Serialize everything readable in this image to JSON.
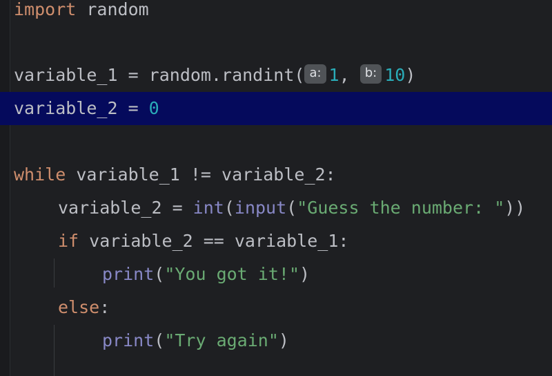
{
  "editor": {
    "colors": {
      "background": "#1e1f22",
      "current_line": "#050a5c",
      "keyword": "#cf8e6d",
      "builtin": "#8888c6",
      "string": "#6aab73",
      "number": "#2aacb8",
      "text": "#bcbec4",
      "inlay_hint_bg": "#505357"
    },
    "lines": [
      {
        "kw": "import",
        "rest": " random"
      },
      {},
      {
        "lhs": "variable_1 = random.randint(",
        "hint_a": "a:",
        "arg_a": "1",
        "sep": ", ",
        "hint_b": "b:",
        "arg_b": "10",
        "close": ")"
      },
      {
        "lhs": "variable_2 = ",
        "value": "0"
      },
      {},
      {
        "kw": "while",
        "rest": " variable_1 != variable_2:"
      },
      {
        "lhs": "variable_2 = ",
        "fn1": "int",
        "p1": "(",
        "fn2": "input",
        "p2": "(",
        "str": "\"Guess the number: \"",
        "close": "))"
      },
      {
        "kw": "if",
        "rest": " variable_2 == variable_1:"
      },
      {
        "fn": "print",
        "open": "(",
        "str": "\"You got it!\"",
        "close": ")"
      },
      {
        "kw": "else",
        "rest": ":"
      },
      {
        "fn": "print",
        "open": "(",
        "str": "\"Try again\"",
        "close": ")"
      }
    ]
  }
}
